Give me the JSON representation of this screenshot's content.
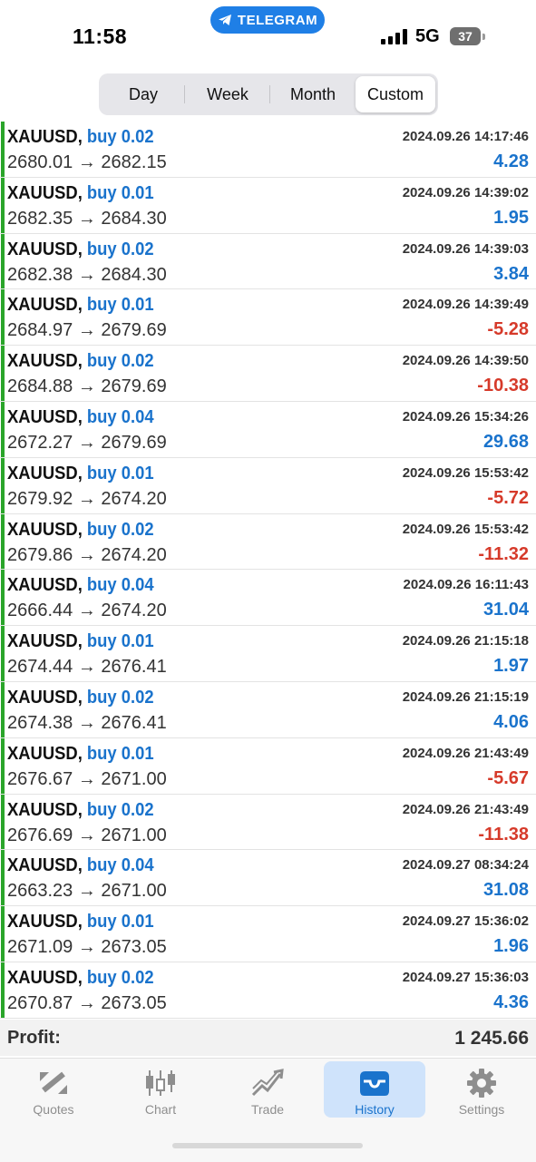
{
  "status_bar": {
    "time": "11:58",
    "pill": "TELEGRAM",
    "network": "5G",
    "battery": "37"
  },
  "period_tabs": [
    {
      "label": "Day",
      "active": false
    },
    {
      "label": "Week",
      "active": false
    },
    {
      "label": "Month",
      "active": false
    },
    {
      "label": "Custom",
      "active": true
    }
  ],
  "deals": [
    {
      "symbol": "XAUUSD,",
      "side": "buy 0.02",
      "prices": "2680.01 → 2682.15",
      "time": "2024.09.26 14:17:46",
      "profit": "4.28"
    },
    {
      "symbol": "XAUUSD,",
      "side": "buy 0.01",
      "prices": "2682.35 → 2684.30",
      "time": "2024.09.26 14:39:02",
      "profit": "1.95"
    },
    {
      "symbol": "XAUUSD,",
      "side": "buy 0.02",
      "prices": "2682.38 → 2684.30",
      "time": "2024.09.26 14:39:03",
      "profit": "3.84"
    },
    {
      "symbol": "XAUUSD,",
      "side": "buy 0.01",
      "prices": "2684.97 → 2679.69",
      "time": "2024.09.26 14:39:49",
      "profit": "-5.28"
    },
    {
      "symbol": "XAUUSD,",
      "side": "buy 0.02",
      "prices": "2684.88 → 2679.69",
      "time": "2024.09.26 14:39:50",
      "profit": "-10.38"
    },
    {
      "symbol": "XAUUSD,",
      "side": "buy 0.04",
      "prices": "2672.27 → 2679.69",
      "time": "2024.09.26 15:34:26",
      "profit": "29.68"
    },
    {
      "symbol": "XAUUSD,",
      "side": "buy 0.01",
      "prices": "2679.92 → 2674.20",
      "time": "2024.09.26 15:53:42",
      "profit": "-5.72"
    },
    {
      "symbol": "XAUUSD,",
      "side": "buy 0.02",
      "prices": "2679.86 → 2674.20",
      "time": "2024.09.26 15:53:42",
      "profit": "-11.32"
    },
    {
      "symbol": "XAUUSD,",
      "side": "buy 0.04",
      "prices": "2666.44 → 2674.20",
      "time": "2024.09.26 16:11:43",
      "profit": "31.04"
    },
    {
      "symbol": "XAUUSD,",
      "side": "buy 0.01",
      "prices": "2674.44 → 2676.41",
      "time": "2024.09.26 21:15:18",
      "profit": "1.97"
    },
    {
      "symbol": "XAUUSD,",
      "side": "buy 0.02",
      "prices": "2674.38 → 2676.41",
      "time": "2024.09.26 21:15:19",
      "profit": "4.06"
    },
    {
      "symbol": "XAUUSD,",
      "side": "buy 0.01",
      "prices": "2676.67 → 2671.00",
      "time": "2024.09.26 21:43:49",
      "profit": "-5.67"
    },
    {
      "symbol": "XAUUSD,",
      "side": "buy 0.02",
      "prices": "2676.69 → 2671.00",
      "time": "2024.09.26 21:43:49",
      "profit": "-11.38"
    },
    {
      "symbol": "XAUUSD,",
      "side": "buy 0.04",
      "prices": "2663.23 → 2671.00",
      "time": "2024.09.27 08:34:24",
      "profit": "31.08"
    },
    {
      "symbol": "XAUUSD,",
      "side": "buy 0.01",
      "prices": "2671.09 → 2673.05",
      "time": "2024.09.27 15:36:02",
      "profit": "1.96"
    },
    {
      "symbol": "XAUUSD,",
      "side": "buy 0.02",
      "prices": "2670.87 → 2673.05",
      "time": "2024.09.27 15:36:03",
      "profit": "4.36"
    }
  ],
  "summary": {
    "label": "Profit:",
    "value": "1 245.66"
  },
  "tab_bar": [
    {
      "label": "Quotes",
      "icon": "quotes-icon",
      "active": false
    },
    {
      "label": "Chart",
      "icon": "chart-icon",
      "active": false
    },
    {
      "label": "Trade",
      "icon": "trade-icon",
      "active": false
    },
    {
      "label": "History",
      "icon": "history-icon",
      "active": true
    },
    {
      "label": "Settings",
      "icon": "gear-icon",
      "active": false
    }
  ],
  "colors": {
    "accent": "#1a73cc",
    "loss": "#d63a2a",
    "buy_marker": "#2aa52a",
    "telegram": "#1f7fe6"
  }
}
